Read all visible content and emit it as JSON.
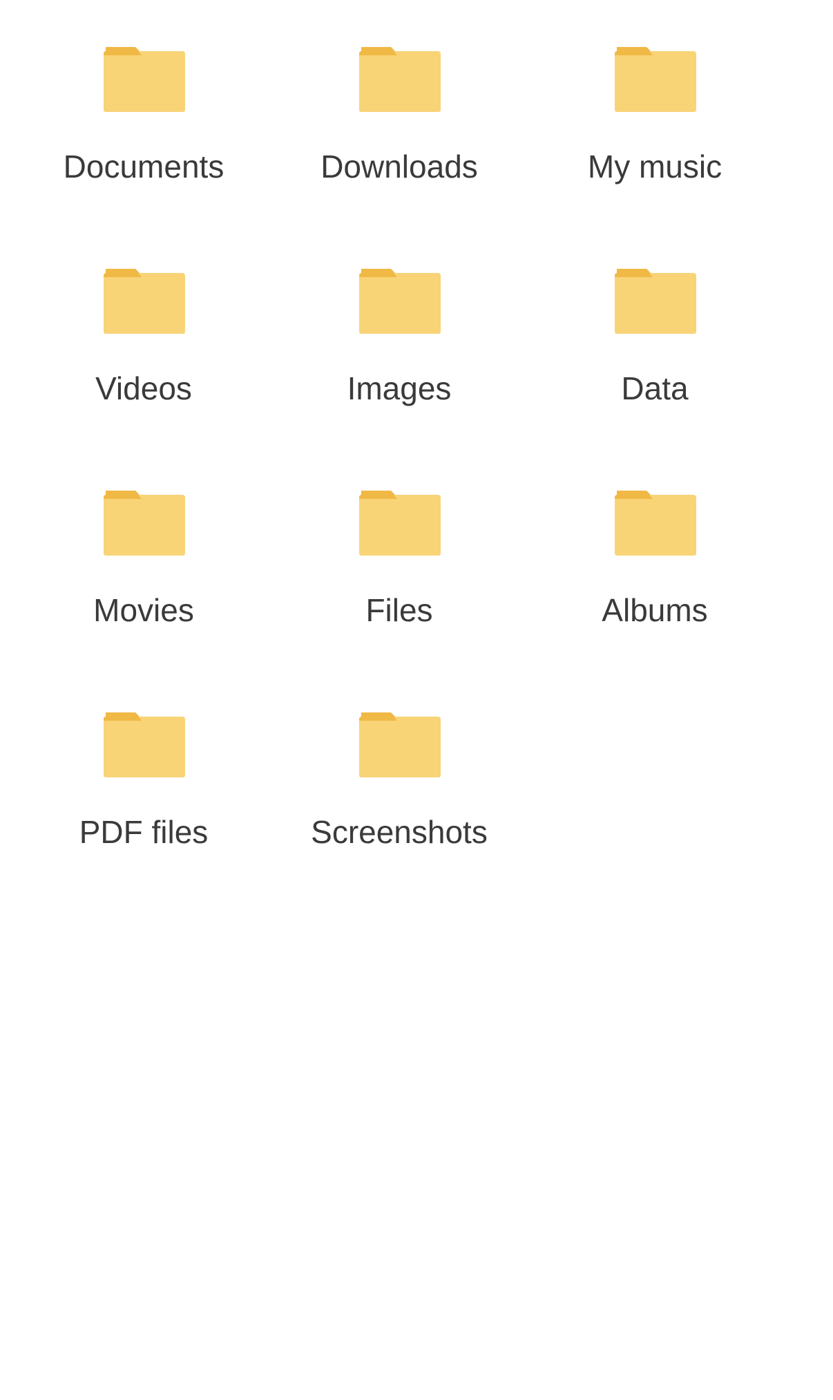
{
  "colors": {
    "folder_body": "#f8d477",
    "folder_tab": "#f0b845",
    "label_text": "#3a3a3a",
    "background": "#ffffff"
  },
  "folders": [
    {
      "label": "Documents",
      "icon": "folder-icon"
    },
    {
      "label": "Downloads",
      "icon": "folder-icon"
    },
    {
      "label": "My music",
      "icon": "folder-icon"
    },
    {
      "label": "Videos",
      "icon": "folder-icon"
    },
    {
      "label": "Images",
      "icon": "folder-icon"
    },
    {
      "label": "Data",
      "icon": "folder-icon"
    },
    {
      "label": "Movies",
      "icon": "folder-icon"
    },
    {
      "label": "Files",
      "icon": "folder-icon"
    },
    {
      "label": "Albums",
      "icon": "folder-icon"
    },
    {
      "label": "PDF files",
      "icon": "folder-icon"
    },
    {
      "label": "Screenshots",
      "icon": "folder-icon"
    }
  ]
}
